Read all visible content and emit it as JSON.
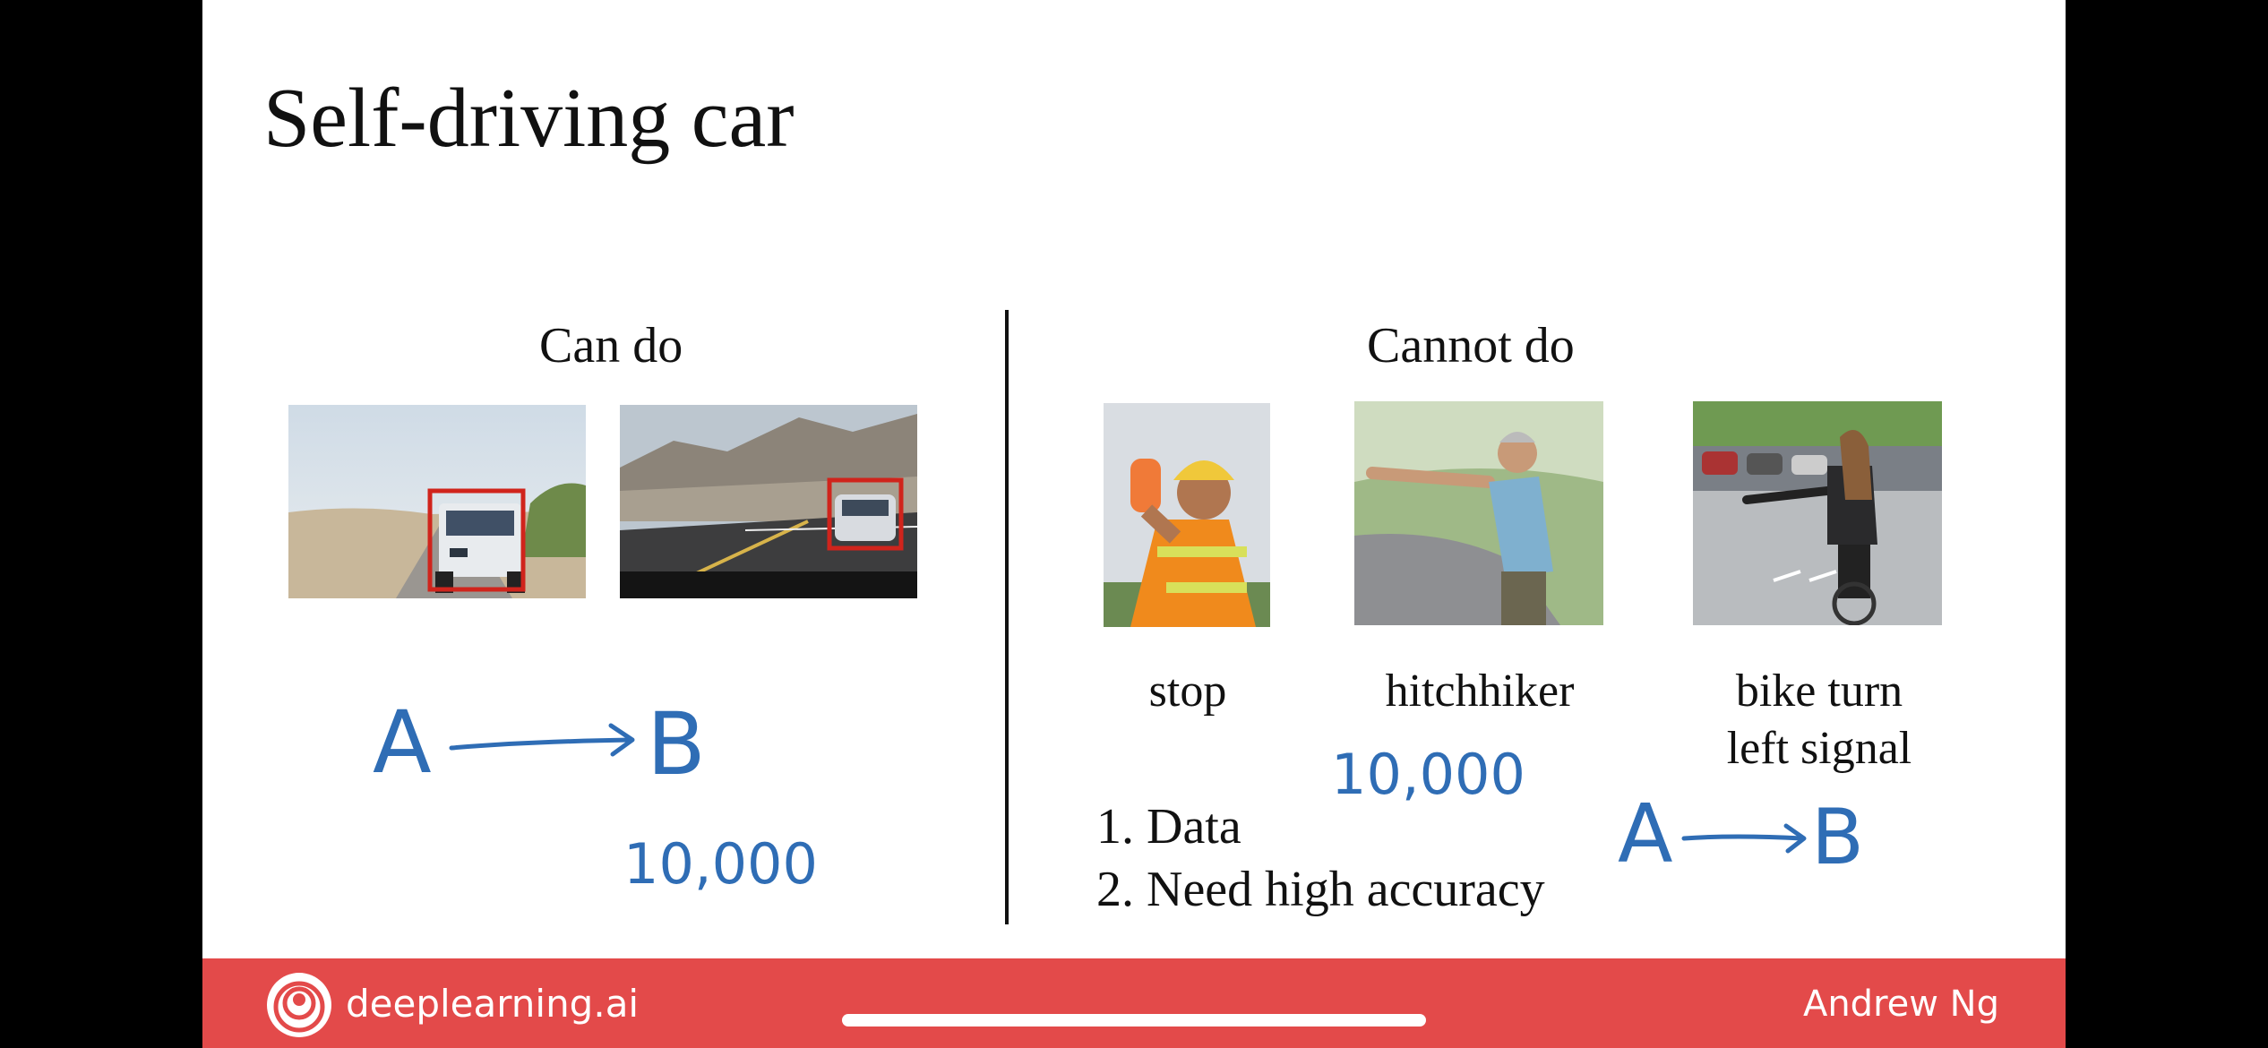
{
  "slide": {
    "title": "Self-driving car",
    "left_heading": "Can do",
    "right_heading": "Cannot do",
    "labels": {
      "stop": "stop",
      "hitchhiker": "hitchhiker",
      "bike_line1": "bike turn",
      "bike_line2": "left signal"
    },
    "list_items": [
      "1. Data",
      "2. Need high accuracy"
    ],
    "annotations": {
      "left_a": "A",
      "left_b": "B",
      "left_count": "10,000",
      "right_count": "10,000",
      "right_a": "A",
      "right_b": "B"
    }
  },
  "footer": {
    "brand": "deeplearning.ai",
    "author": "Andrew Ng"
  },
  "colors": {
    "footer": "#e34a4a",
    "ink": "#2f6db5",
    "box": "#d0241c"
  }
}
